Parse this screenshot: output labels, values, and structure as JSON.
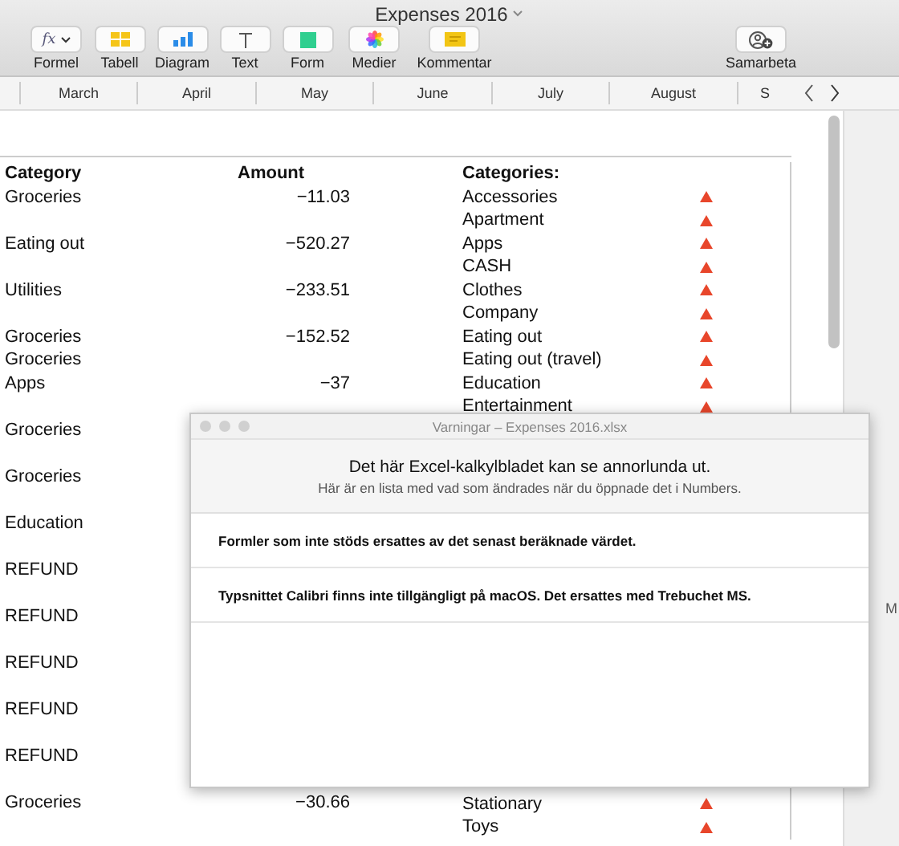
{
  "window": {
    "title": "Expenses 2016"
  },
  "toolbar": {
    "buttons": [
      {
        "kind": "formula",
        "label": "Formel",
        "icon_text": "fx"
      },
      {
        "kind": "table",
        "label": "Tabell"
      },
      {
        "kind": "chart",
        "label": "Diagram"
      },
      {
        "kind": "text",
        "label": "Text"
      },
      {
        "kind": "shape",
        "label": "Form"
      },
      {
        "kind": "media",
        "label": "Medier"
      },
      {
        "kind": "comment",
        "label": "Kommentar"
      },
      {
        "kind": "collaborate",
        "label": "Samarbeta"
      }
    ]
  },
  "sheet_tabs": [
    "March",
    "April",
    "May",
    "June",
    "July",
    "August",
    "S"
  ],
  "expenses_table": {
    "columns": [
      "Category",
      "Amount"
    ],
    "rows": [
      {
        "category": "Groceries",
        "amount": "−11.03",
        "kind": "tall"
      },
      {
        "category": "Eating out",
        "amount": "−520.27",
        "kind": "tall"
      },
      {
        "category": "Utilities",
        "amount": "−233.51",
        "kind": "tall"
      },
      {
        "category": "Groceries",
        "amount": "−152.52",
        "kind": "short"
      },
      {
        "category": "Groceries",
        "kind": "short"
      },
      {
        "category": "Apps",
        "amount": "−37",
        "kind": "tall"
      },
      {
        "category": "Groceries",
        "kind": "tall"
      },
      {
        "category": "Groceries",
        "kind": "tall"
      },
      {
        "category": "Education",
        "kind": "tall"
      },
      {
        "category": "REFUND",
        "kind": "tall"
      },
      {
        "category": "REFUND",
        "kind": "tall"
      },
      {
        "category": "REFUND",
        "kind": "tall"
      },
      {
        "category": "REFUND",
        "kind": "tall"
      },
      {
        "category": "REFUND",
        "kind": "tall"
      },
      {
        "category": "Groceries",
        "amount": "−30.66",
        "kind": "tall"
      }
    ]
  },
  "categories_table": {
    "title": "Categories:",
    "items_top": [
      "Accessories",
      "Apartment",
      "Apps",
      "CASH",
      "Clothes",
      "Company",
      "Eating out",
      "Eating out (travel)",
      "Education",
      "Entertainment"
    ],
    "items_bottom": [
      "Stationary",
      "Toys"
    ]
  },
  "side_text": "M",
  "dialog": {
    "title": "Varningar – Expenses 2016.xlsx",
    "heading": "Det här Excel-kalkylbladet kan se annorlunda ut.",
    "subheading": "Här är en lista med vad som ändrades när du öppnade det i Numbers.",
    "warnings": [
      "Formler som inte stöds ersattes av det senast beräknade värdet.",
      "Typsnittet Calibri finns inte tillgängligt på macOS. Det ersattes med Trebuchet MS."
    ]
  }
}
